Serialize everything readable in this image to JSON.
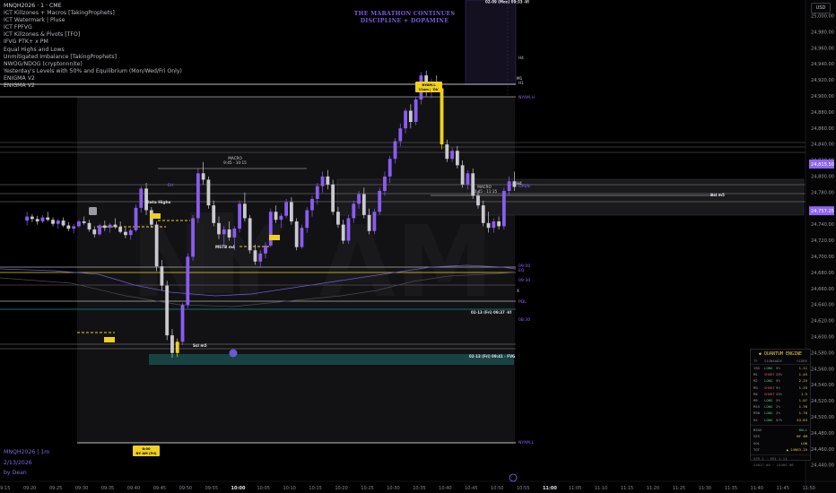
{
  "legend": {
    "symbol_line": "MNQH2026 · 1 · CME",
    "indicators": [
      "ICT Killzones + Macros [TakingProphets]",
      "ICT Watermark | Pluse",
      "ICT FPFVG",
      "ICT Killzones & Pivots [TFO]",
      "IFVG PTK+ x PM",
      "Equal Highs and Lows",
      "Unmitigated Imbalance [TakingProphets]",
      "NWOG/NDOG (cryptonnnite)",
      "Yesterday's Levels with 50% and Equilibrium (Mon/Wed/Fri Only)",
      "ENIGMA V2",
      "ENIGMA V2"
    ]
  },
  "banner": [
    "THE MARATHON CONTINUES",
    "DISCIPLINE + DOPAMINE"
  ],
  "watermark": "NY AM",
  "currency": "USD",
  "signature": {
    "symbol": "MNQH2026 | 1m",
    "date": "2/13/2026",
    "author": "by Dean"
  },
  "colors": {
    "bull": "#8a5cf0",
    "bear": "#c9c9cf",
    "highlight": "#f0d020",
    "fvg": "#1d6b68",
    "accent": "#8e64f2"
  },
  "annotations": {
    "macro1": "MACRO\n9:45 - 10:15",
    "macro2": "MACRO\n10:45 - 11:15",
    "data_highs": "Data Highs",
    "nyam_h": "NYAM.H",
    "nyam_l": "NYAM.L",
    "h1": "H1",
    "h4": "H4",
    "bsl_m5": "Bsl m5",
    "open": "OPEN",
    "eq": "EQ",
    "pdl": "PDL",
    "t0900": "09:00",
    "t0930": "09:30",
    "t0830": "08:30",
    "nyam_tag": "NY AM",
    "box_label1": "02-09 (Mon) 09:33 -VI",
    "box_label2": "02-13 (Fri) 09:37 -VI",
    "box_label3": "02-13 (Fri) 09:41 - FVG",
    "ssl_label": "Ssl m5",
    "mstb_label": "MSTB m4",
    "eh_label": "EH",
    "ny_tag_top": "NYAM.L\n11am | 'Ok'",
    "ny_tag_bot": "8:00\nNY AM (Fri)",
    "h4_marker": "H4",
    "x_marker": "X",
    "m1_marker": "M1"
  },
  "quantum_engine": {
    "title": "◆ QUANTUM ENGINE",
    "headers": [
      "TF",
      "SIGNAL",
      "ADX",
      "SCORE",
      ""
    ],
    "rows": [
      [
        "15S",
        "LONG",
        "5%",
        "1.11",
        ""
      ],
      [
        "M1",
        "SHORT",
        "25%",
        "1.45",
        ""
      ],
      [
        "M2",
        "LONG",
        "5%",
        "2.25",
        ""
      ],
      [
        "M3",
        "SHORT",
        "5%",
        "1.25",
        ""
      ],
      [
        "M4",
        "SHORT",
        "25%",
        "1.5",
        ""
      ],
      [
        "M5",
        "LONG",
        "5%",
        "1.07",
        ""
      ],
      [
        "M15",
        "LONG",
        "2%",
        "1.76",
        ""
      ],
      [
        "M30",
        "LONG",
        "2%",
        "1.70",
        ""
      ],
      [
        "H1",
        "LONG",
        "57%",
        "53.83",
        ""
      ]
    ],
    "summary": [
      [
        "BIAS",
        "BULL"
      ],
      [
        "SES",
        "NY AM"
      ],
      [
        "VOL",
        "LOW"
      ],
      [
        "TGT",
        "▲ 24963.25"
      ]
    ],
    "footer": [
      "ATR 1 · ERI 1.11",
      "24817.00 · 24485.00"
    ]
  },
  "chart_data": {
    "type": "candlestick",
    "price_axis": {
      "min": 24420,
      "max": 25020,
      "ticks": [
        25000,
        24980,
        24960,
        24940,
        24920,
        24900,
        24880,
        24860,
        24840,
        24820,
        24800,
        24780,
        24760,
        24740,
        24720,
        24700,
        24680,
        24660,
        24640,
        24620,
        24600,
        24580,
        24560,
        24540,
        24520,
        24500,
        24480,
        24460,
        24440
      ],
      "tick_labels": [
        "25,000.00",
        "24,980.00",
        "24,960.00",
        "24,940.00",
        "24,920.00",
        "24,900.00",
        "24,880.00",
        "24,860.00",
        "24,840.00",
        "24,820.00",
        "24,800.00",
        "24,780.00",
        "24,760.00",
        "24,740.00",
        "24,720.00",
        "24,700.00",
        "24,680.00",
        "24,660.00",
        "24,640.00",
        "24,620.00",
        "24,600.00",
        "24,580.00",
        "24,560.00",
        "24,540.00",
        "24,520.00",
        "24,500.00",
        "24,480.00",
        "24,460.00",
        "24,440.00"
      ],
      "price_tags": [
        {
          "label": "24,815.50",
          "value": 24815.5,
          "color": "#8e64f2"
        },
        {
          "label": "24,757.25",
          "value": 24757.25,
          "color": "#8e64f2"
        }
      ]
    },
    "time_axis": {
      "labels": [
        "09:15",
        "09:20",
        "09:25",
        "09:30",
        "09:35",
        "09:40",
        "09:45",
        "09:50",
        "09:55",
        "10:00",
        "10:05",
        "10:10",
        "10:15",
        "10:20",
        "10:25",
        "10:30",
        "10:35",
        "10:40",
        "10:45",
        "10:50",
        "10:55",
        "11:00",
        "11:05",
        "11:10",
        "11:15",
        "11:20",
        "11:25",
        "11:30",
        "11:35",
        "11:40",
        "11:45",
        "11:50"
      ],
      "bold": [
        "10:00",
        "11:00"
      ]
    },
    "candles": [
      [
        24745,
        24756,
        24739,
        24750
      ],
      [
        24750,
        24753,
        24743,
        24747
      ],
      [
        24747,
        24751,
        24740,
        24744
      ],
      [
        24744,
        24752,
        24742,
        24749
      ],
      [
        24749,
        24756,
        24744,
        24746
      ],
      [
        24746,
        24749,
        24738,
        24741
      ],
      [
        24741,
        24747,
        24735,
        24745
      ],
      [
        24745,
        24749,
        24737,
        24739
      ],
      [
        24739,
        24743,
        24732,
        24735
      ],
      [
        24735,
        24741,
        24729,
        24738
      ],
      [
        24738,
        24746,
        24736,
        24744
      ],
      [
        24744,
        24750,
        24740,
        24742
      ],
      [
        24742,
        24746,
        24731,
        24734
      ],
      [
        24734,
        24738,
        24724,
        24728
      ],
      [
        24728,
        24741,
        24726,
        24739
      ],
      [
        24739,
        24745,
        24732,
        24736
      ],
      [
        24736,
        24742,
        24730,
        24740
      ],
      [
        24740,
        24748,
        24735,
        24737
      ],
      [
        24737,
        24744,
        24729,
        24731
      ],
      [
        24731,
        24736,
        24723,
        24727
      ],
      [
        24727,
        24735,
        24721,
        24733
      ],
      [
        24733,
        24765,
        24731,
        24761
      ],
      [
        24761,
        24788,
        24755,
        24785
      ],
      [
        24785,
        24792,
        24752,
        24758
      ],
      [
        24758,
        24762,
        24736,
        24740
      ],
      [
        24740,
        24744,
        24682,
        24688
      ],
      [
        24688,
        24696,
        24658,
        24664
      ],
      [
        24664,
        24670,
        24596,
        24602
      ],
      [
        24602,
        24610,
        24574,
        24580
      ],
      [
        24580,
        24598,
        24575,
        24594
      ],
      [
        24594,
        24642,
        24590,
        24640
      ],
      [
        24640,
        24704,
        24636,
        24700
      ],
      [
        24700,
        24752,
        24695,
        24748
      ],
      [
        24748,
        24810,
        24742,
        24804
      ],
      [
        24804,
        24818,
        24790,
        24796
      ],
      [
        24796,
        24800,
        24760,
        24764
      ],
      [
        24764,
        24770,
        24738,
        24742
      ],
      [
        24742,
        24750,
        24722,
        24728
      ],
      [
        24728,
        24738,
        24714,
        24734
      ],
      [
        24734,
        24744,
        24720,
        24724
      ],
      [
        24724,
        24738,
        24708,
        24735
      ],
      [
        24735,
        24770,
        24730,
        24766
      ],
      [
        24766,
        24780,
        24744,
        24748
      ],
      [
        24748,
        24752,
        24704,
        24708
      ],
      [
        24708,
        24715,
        24690,
        24694
      ],
      [
        24694,
        24708,
        24686,
        24704
      ],
      [
        24704,
        24718,
        24698,
        24714
      ],
      [
        24714,
        24760,
        24712,
        24756
      ],
      [
        24756,
        24764,
        24742,
        24746
      ],
      [
        24746,
        24754,
        24736,
        24751
      ],
      [
        24751,
        24772,
        24748,
        24768
      ],
      [
        24768,
        24774,
        24740,
        24744
      ],
      [
        24744,
        24748,
        24708,
        24712
      ],
      [
        24712,
        24740,
        24710,
        24736
      ],
      [
        24736,
        24762,
        24730,
        24758
      ],
      [
        24758,
        24776,
        24750,
        24772
      ],
      [
        24772,
        24792,
        24765,
        24788
      ],
      [
        24788,
        24806,
        24780,
        24800
      ],
      [
        24800,
        24808,
        24784,
        24790
      ],
      [
        24790,
        24796,
        24752,
        24756
      ],
      [
        24756,
        24762,
        24736,
        24740
      ],
      [
        24740,
        24746,
        24716,
        24720
      ],
      [
        24720,
        24752,
        24716,
        24748
      ],
      [
        24748,
        24770,
        24742,
        24766
      ],
      [
        24766,
        24782,
        24760,
        24778
      ],
      [
        24778,
        24786,
        24748,
        24752
      ],
      [
        24752,
        24760,
        24728,
        24732
      ],
      [
        24732,
        24760,
        24728,
        24756
      ],
      [
        24756,
        24786,
        24752,
        24782
      ],
      [
        24782,
        24806,
        24776,
        24800
      ],
      [
        24800,
        24826,
        24792,
        24822
      ],
      [
        24822,
        24848,
        24816,
        24844
      ],
      [
        24844,
        24866,
        24838,
        24860
      ],
      [
        24860,
        24885,
        24854,
        24882
      ],
      [
        24882,
        24890,
        24860,
        24868
      ],
      [
        24868,
        24900,
        24864,
        24896
      ],
      [
        24896,
        24930,
        24890,
        24926
      ],
      [
        24926,
        24932,
        24900,
        24906
      ],
      [
        24906,
        24922,
        24898,
        24918
      ],
      [
        24918,
        24926,
        24905,
        24910
      ],
      [
        24910,
        24916,
        24834,
        24840
      ],
      [
        24840,
        24846,
        24818,
        24822
      ],
      [
        24822,
        24836,
        24818,
        24832
      ],
      [
        24832,
        24838,
        24810,
        24814
      ],
      [
        24814,
        24820,
        24786,
        24790
      ],
      [
        24790,
        24808,
        24784,
        24804
      ],
      [
        24804,
        24810,
        24772,
        24776
      ],
      [
        24776,
        24782,
        24760,
        24764
      ],
      [
        24764,
        24770,
        24738,
        24742
      ],
      [
        24742,
        24756,
        24730,
        24736
      ],
      [
        24736,
        24748,
        24730,
        24744
      ],
      [
        24744,
        24750,
        24734,
        24738
      ],
      [
        24738,
        24786,
        24734,
        24782
      ],
      [
        24782,
        24800,
        24776,
        24794
      ],
      [
        24794,
        24806,
        24782,
        24787
      ]
    ],
    "highlight_candles": [
      29,
      80
    ],
    "levels": [
      {
        "name": "nyam-high",
        "value": 24928
      },
      {
        "name": "nyam-low",
        "value": 24508
      },
      {
        "name": "open",
        "value": 24837
      },
      {
        "name": "eq",
        "value": 24754
      },
      {
        "name": "pdl",
        "value": 24724
      }
    ]
  }
}
